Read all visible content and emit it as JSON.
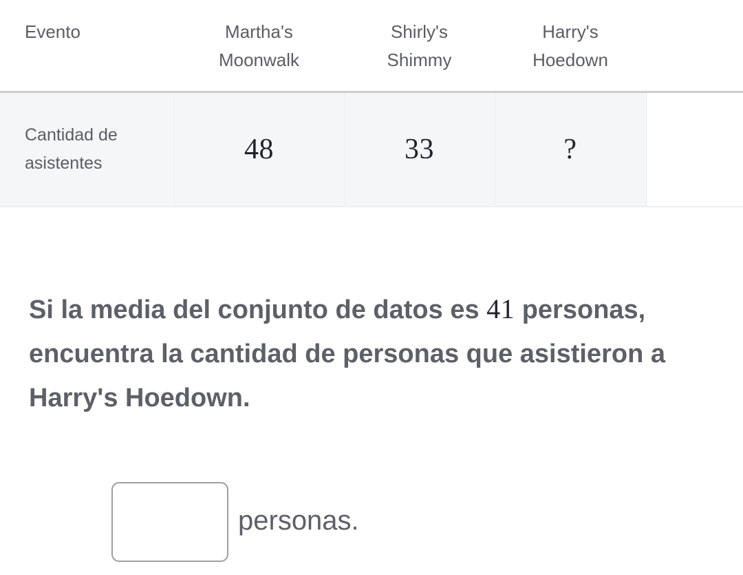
{
  "table": {
    "header": {
      "label_column": "Evento",
      "columns": [
        {
          "line1": "Martha's",
          "line2": "Moonwalk"
        },
        {
          "line1": "Shirly's",
          "line2": "Shimmy"
        },
        {
          "line1": "Harry's",
          "line2": "Hoedown"
        }
      ]
    },
    "row": {
      "label_line1": "Cantidad de",
      "label_line2": "asistentes",
      "values": [
        "48",
        "33",
        "?"
      ]
    }
  },
  "question": {
    "part1": "Si la media del conjunto de datos es ",
    "mean_value": "41",
    "part2": " personas, encuentra la cantidad de personas que asistieron a Harry's Hoedown."
  },
  "answer": {
    "input_value": "",
    "input_placeholder": "",
    "unit_label": "personas."
  },
  "chart_data": {
    "type": "table",
    "title": "",
    "categories": [
      "Martha's Moonwalk",
      "Shirly's Shimmy",
      "Harry's Hoedown"
    ],
    "row_label": "Cantidad de asistentes",
    "values": [
      48,
      33,
      null
    ],
    "value_labels": [
      "48",
      "33",
      "?"
    ],
    "mean": 41,
    "xlabel": "Evento",
    "ylabel": "Cantidad de asistentes"
  },
  "colors": {
    "text_gray": "#5a5d64",
    "math_dark": "#21242c",
    "row_background": "#f5f6f8",
    "header_rule": "#cccdd0",
    "input_border": "#9b9ea3"
  }
}
